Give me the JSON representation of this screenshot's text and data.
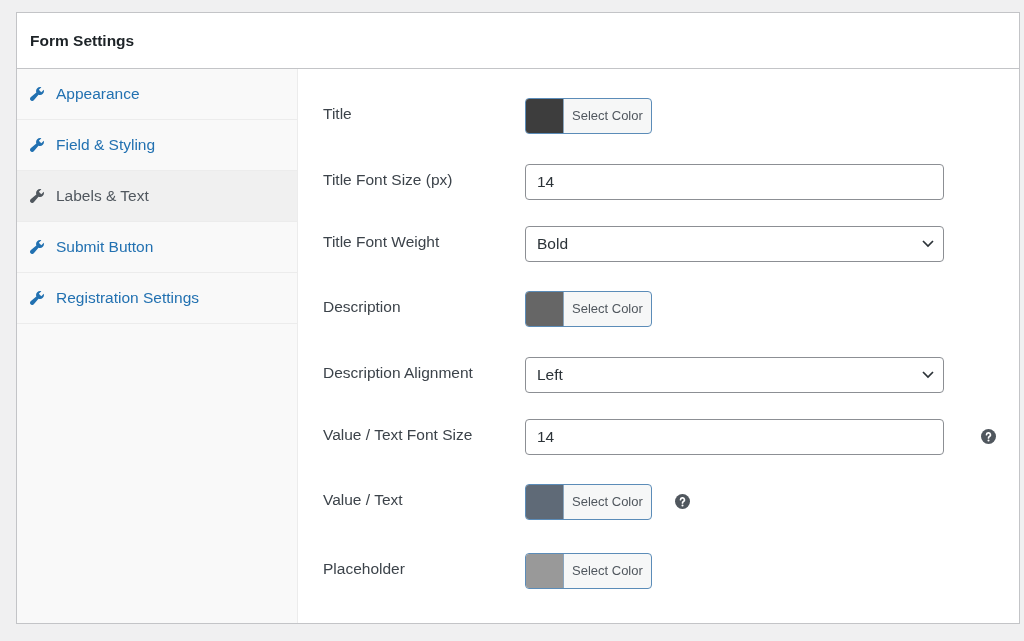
{
  "panel": {
    "title": "Form Settings"
  },
  "sidebar": {
    "items": [
      {
        "label": "Appearance",
        "selected": false
      },
      {
        "label": "Field & Styling",
        "selected": false
      },
      {
        "label": "Labels & Text",
        "selected": true
      },
      {
        "label": "Submit Button",
        "selected": false
      },
      {
        "label": "Registration Settings",
        "selected": false
      }
    ]
  },
  "settings": [
    {
      "label": "Title",
      "kind": "color",
      "color": "#3d3d3d",
      "button": "Select Color",
      "help": false
    },
    {
      "label": "Title Font Size (px)",
      "kind": "number",
      "value": "14",
      "help": false
    },
    {
      "label": "Title Font Weight",
      "kind": "select",
      "value": "Bold",
      "help": false
    },
    {
      "label": "Description",
      "kind": "color",
      "color": "#666666",
      "button": "Select Color",
      "help": false
    },
    {
      "label": "Description Alignment",
      "kind": "select",
      "value": "Left",
      "help": false
    },
    {
      "label": "Value / Text Font Size",
      "kind": "number",
      "value": "14",
      "help": true
    },
    {
      "label": "Value / Text",
      "kind": "color",
      "color": "#5f6a77",
      "button": "Select Color",
      "help": true
    },
    {
      "label": "Placeholder",
      "kind": "color",
      "color": "#999999",
      "button": "Select Color",
      "help": false
    }
  ]
}
